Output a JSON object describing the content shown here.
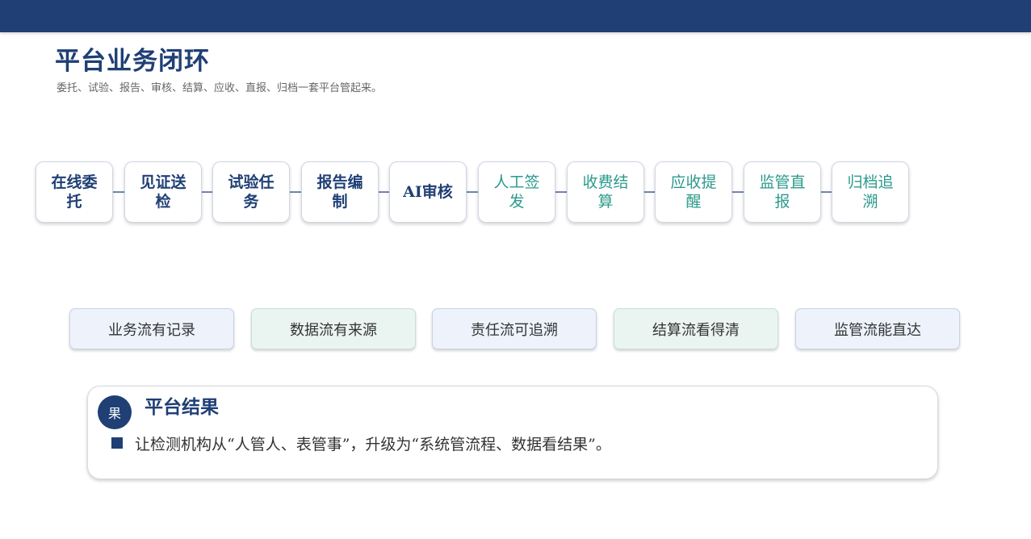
{
  "header": {
    "title": "平台业务闭环",
    "subtitle": "委托、试验、报告、审核、结算、应收、直报、归档一套平台管起来。"
  },
  "flow": {
    "steps": [
      {
        "label": "在线委托",
        "tone": "navy"
      },
      {
        "label": "见证送检",
        "tone": "navy"
      },
      {
        "label": "试验任务",
        "tone": "navy"
      },
      {
        "label": "报告编制",
        "tone": "navy"
      },
      {
        "label": "AI审核",
        "tone": "navy"
      },
      {
        "label": "人工签发",
        "tone": "teal"
      },
      {
        "label": "收费结算",
        "tone": "teal"
      },
      {
        "label": "应收提醒",
        "tone": "teal"
      },
      {
        "label": "监管直报",
        "tone": "teal"
      },
      {
        "label": "归档追溯",
        "tone": "teal"
      }
    ]
  },
  "tags": [
    {
      "label": "业务流有记录",
      "tone": "blue"
    },
    {
      "label": "数据流有来源",
      "tone": "green"
    },
    {
      "label": "责任流可追溯",
      "tone": "blue"
    },
    {
      "label": "结算流看得清",
      "tone": "green"
    },
    {
      "label": "监管流能直达",
      "tone": "blue"
    }
  ],
  "result": {
    "badge": "果",
    "title": "平台结果",
    "text": "让检测机构从“人管人、表管事”，升级为“系统管流程、数据看结果”。"
  },
  "colors": {
    "navy": "#1f3f75",
    "teal": "#2b9a8c",
    "tag_blue_bg": "#edf2fb",
    "tag_green_bg": "#eaf5f2"
  }
}
